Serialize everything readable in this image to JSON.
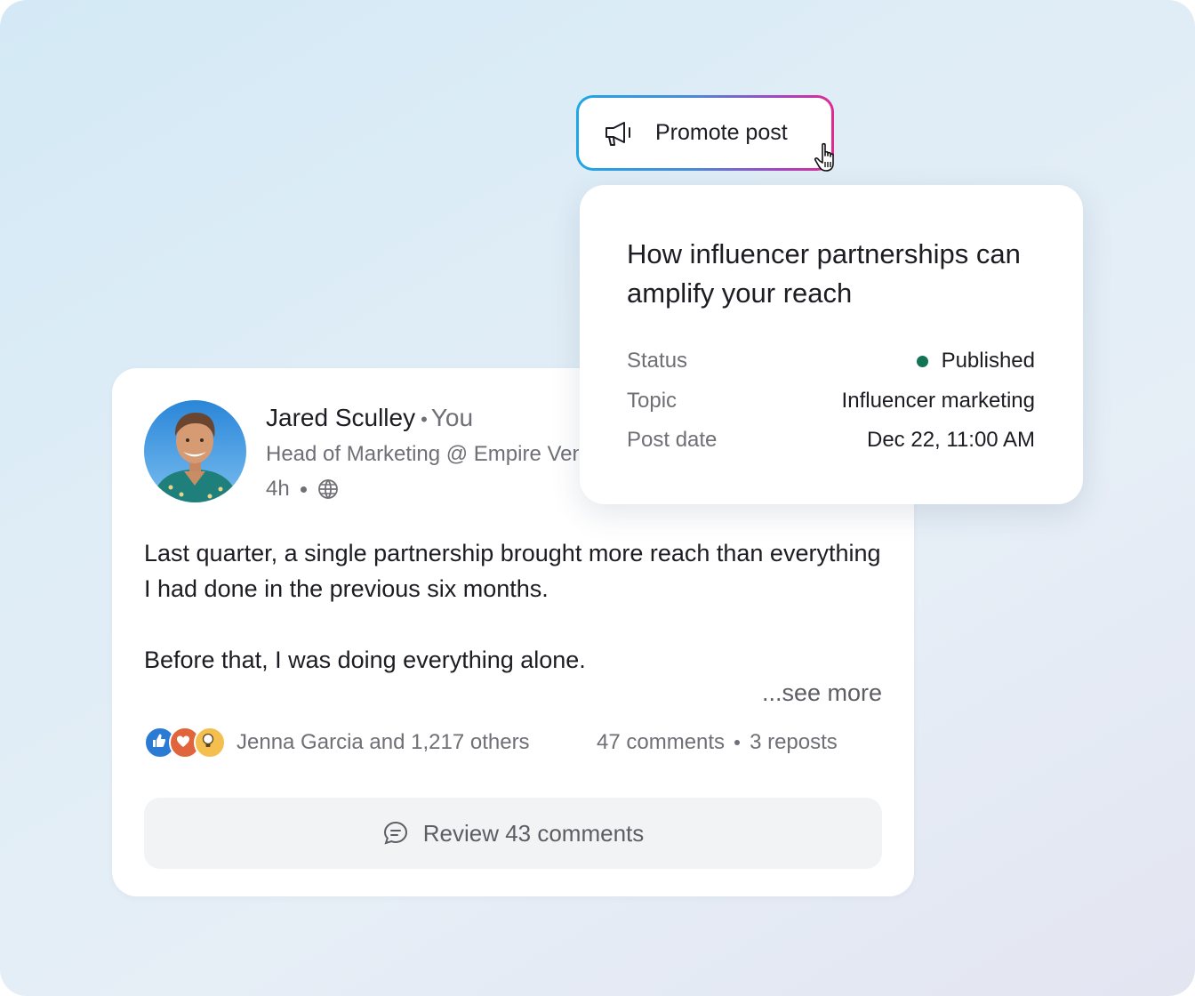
{
  "promote_button": {
    "label": "Promote post",
    "icon": "megaphone-icon"
  },
  "detail": {
    "title": "How influencer partnerships can amplify your reach",
    "rows": [
      {
        "label": "Status",
        "value": "Published",
        "status_color": "#127455"
      },
      {
        "label": "Topic",
        "value": "Influencer marketing"
      },
      {
        "label": "Post date",
        "value": "Dec 22, 11:00 AM"
      }
    ]
  },
  "post": {
    "author_name": "Jared Sculley",
    "relation": "You",
    "author_title": "Head of Marketing @ Empire Ventures",
    "age": "4h",
    "visibility_icon": "globe-icon",
    "paragraphs": [
      "Last quarter, a single partnership brought more reach than everything I had done in the previous six months.",
      "Before that, I was doing everything alone."
    ],
    "see_more": "...see more",
    "reactions_icons": [
      "like-icon",
      "love-icon",
      "insightful-icon"
    ],
    "reactions_text": "Jenna Garcia and 1,217 others",
    "comments_count": "47 comments",
    "reposts_count": "3 reposts",
    "review_button": "Review 43 comments"
  },
  "colors": {
    "accent_gradient_start": "#1ea6e6",
    "accent_gradient_end": "#e02a8f",
    "text_primary": "#1c1c22",
    "text_secondary": "#6f6f76"
  }
}
